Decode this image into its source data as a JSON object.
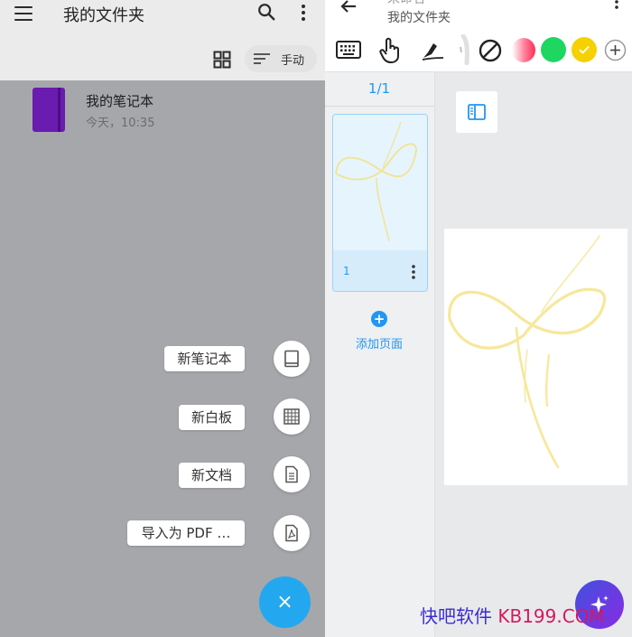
{
  "left": {
    "title": "我的文件夹",
    "sort_label": "手动",
    "notebook": {
      "name": "我的笔记本",
      "date": "今天，10:35",
      "cover_color": "#6a1bb0"
    },
    "menu": [
      {
        "label": "新笔记本",
        "icon": "notebook-icon"
      },
      {
        "label": "新白板",
        "icon": "whiteboard-icon"
      },
      {
        "label": "新文档",
        "icon": "document-icon"
      },
      {
        "label": "导入为 PDF …",
        "icon": "pdf-icon"
      }
    ],
    "fab_label": "×"
  },
  "right": {
    "title_partial": "未命名",
    "folder": "我的文件夹",
    "toolbar": {
      "icons": [
        "keyboard-icon",
        "touch-icon",
        "pen-tool-icon",
        "highlighter-icon",
        "eraser-icon"
      ],
      "colors": [
        "#ff6b81",
        "#1ed760",
        "#f5d100"
      ],
      "add_icon": "add-color-icon"
    },
    "page_count": "1/1",
    "thumb_number": "1",
    "add_page_label": "添加页面",
    "ink_color": "#f7e79a"
  },
  "watermark": {
    "part1": "快吧软件",
    "part2": "KB199.COM"
  },
  "colors": {
    "accent": "#2196f3",
    "fab": "#23a8f0"
  }
}
